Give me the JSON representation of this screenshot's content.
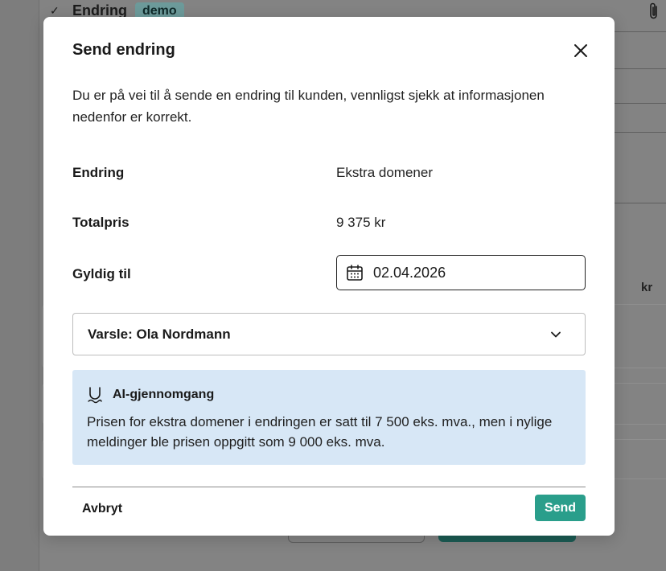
{
  "background": {
    "header_title": "Endring",
    "badge": "demo",
    "currency_label": "kr"
  },
  "modal": {
    "title": "Send endring",
    "intro": "Du er på vei til å sende en endring til kunden, vennligst sjekk at informasjonen nedenfor er korrekt.",
    "rows": [
      {
        "label": "Endring",
        "value": "Ekstra domener"
      },
      {
        "label": "Totalpris",
        "value": "9 375 kr"
      }
    ],
    "valid_until": {
      "label": "Gyldig til",
      "value": "02.04.2026"
    },
    "notify_select": {
      "value": "Varsle: Ola Nordmann"
    },
    "ai_review": {
      "title": "AI-gjennomgang",
      "text": "Prisen for ekstra domener i endringen er satt til 7 500 eks. mva., men i nylige meldinger ble prisen oppgitt som 9 000 eks. mva."
    },
    "footer": {
      "cancel_label": "Avbryt",
      "send_label": "Send"
    }
  },
  "colors": {
    "backdrop": "#7d7d7d",
    "accent": "#2a9e8b",
    "ai_box": "#d7e7f6"
  },
  "icons": [
    "check-icon",
    "paperclip-icon",
    "close-icon",
    "calendar-icon",
    "chevron-down-icon",
    "ai-icon"
  ]
}
